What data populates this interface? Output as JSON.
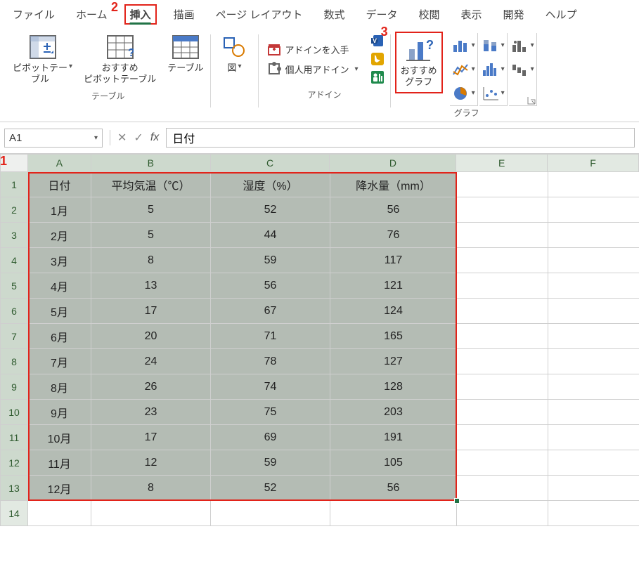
{
  "tabs": {
    "file": "ファイル",
    "home": "ホーム",
    "insert": "挿入",
    "draw": "描画",
    "layout": "ページ レイアウト",
    "formulas": "数式",
    "data": "データ",
    "review": "校閲",
    "view": "表示",
    "developer": "開発",
    "help": "ヘルプ"
  },
  "annotations": {
    "n1": "1",
    "n2": "2",
    "n3": "3"
  },
  "ribbon": {
    "tables": {
      "pivot": "ピボットテー\nブル",
      "recommended_pivot": "おすすめ\nピボットテーブル",
      "table": "テーブル",
      "caption": "テーブル"
    },
    "illustrations": {
      "label": "図"
    },
    "addins": {
      "get": "アドインを入手",
      "my": "個人用アドイン",
      "caption": "アドイン"
    },
    "charts": {
      "recommended": "おすすめ\nグラフ",
      "caption": "グラフ"
    }
  },
  "formula_bar": {
    "name_box": "A1",
    "fx": "fx",
    "value": "日付"
  },
  "columns": [
    "A",
    "B",
    "C",
    "D",
    "E",
    "F"
  ],
  "row_nums": [
    "1",
    "2",
    "3",
    "4",
    "5",
    "6",
    "7",
    "8",
    "9",
    "10",
    "11",
    "12",
    "13",
    "14"
  ],
  "table": {
    "headers": {
      "A": "日付",
      "B": "平均気温（℃）",
      "C": "湿度（%）",
      "D": "降水量（mm）"
    },
    "rows": [
      {
        "A": "1月",
        "B": "5",
        "C": "52",
        "D": "56"
      },
      {
        "A": "2月",
        "B": "5",
        "C": "44",
        "D": "76"
      },
      {
        "A": "3月",
        "B": "8",
        "C": "59",
        "D": "117"
      },
      {
        "A": "4月",
        "B": "13",
        "C": "56",
        "D": "121"
      },
      {
        "A": "5月",
        "B": "17",
        "C": "67",
        "D": "124"
      },
      {
        "A": "6月",
        "B": "20",
        "C": "71",
        "D": "165"
      },
      {
        "A": "7月",
        "B": "24",
        "C": "78",
        "D": "127"
      },
      {
        "A": "8月",
        "B": "26",
        "C": "74",
        "D": "128"
      },
      {
        "A": "9月",
        "B": "23",
        "C": "75",
        "D": "203"
      },
      {
        "A": "10月",
        "B": "17",
        "C": "69",
        "D": "191"
      },
      {
        "A": "11月",
        "B": "12",
        "C": "59",
        "D": "105"
      },
      {
        "A": "12月",
        "B": "8",
        "C": "52",
        "D": "56"
      }
    ]
  }
}
